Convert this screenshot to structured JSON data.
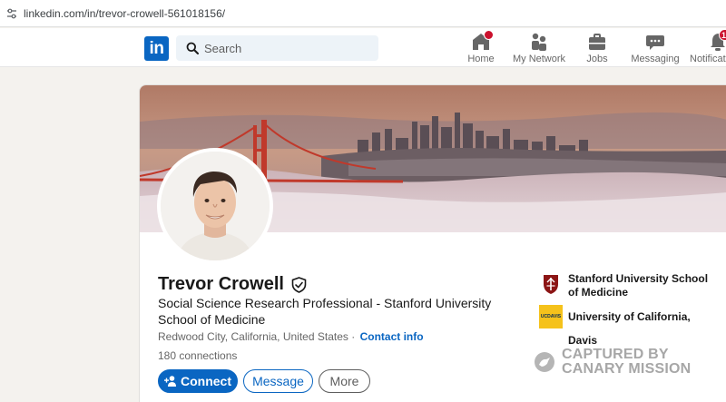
{
  "browser": {
    "url": "linkedin.com/in/trevor-crowell-561018156/",
    "site_icon": "tune-icon"
  },
  "nav": {
    "logo_text": "in",
    "search_placeholder": "Search",
    "items": [
      {
        "label": "Home",
        "icon": "home-icon"
      },
      {
        "label": "My Network",
        "icon": "network-icon"
      },
      {
        "label": "Jobs",
        "icon": "briefcase-icon"
      },
      {
        "label": "Messaging",
        "icon": "messaging-icon"
      },
      {
        "label": "Notificati",
        "icon": "bell-icon",
        "badge": "12"
      }
    ]
  },
  "profile": {
    "name": "Trevor Crowell",
    "headline": "Social Science Research Professional - Stanford University School of Medicine",
    "location": "Redwood City, California, United States",
    "location_separator": "·",
    "contact_info": "Contact info",
    "connections": "180 connections",
    "actions": {
      "connect": "Connect",
      "message": "Message",
      "more": "More"
    },
    "education": [
      {
        "name": "Stanford University School of Medicine",
        "logo": "stanford-shield-icon"
      },
      {
        "name": "University of California, Davis",
        "logo": "ucdavis-logo",
        "logo_text": "UCDAVIS"
      }
    ]
  },
  "watermark": {
    "line1": "CAPTURED BY",
    "line2": "CANARY MISSION"
  },
  "colors": {
    "brand": "#0a66c2",
    "badge": "#cb112d",
    "page_bg": "#f4f2ee"
  }
}
